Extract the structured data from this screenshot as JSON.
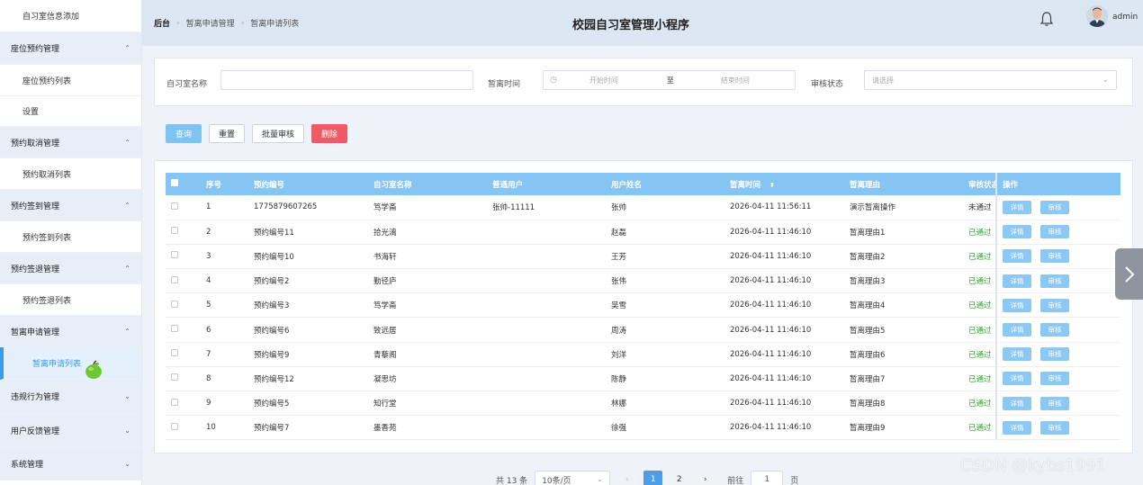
{
  "sidebar": {
    "items": [
      {
        "label": "自习室信息添加",
        "type": "sub"
      },
      {
        "label": "座位预约管理",
        "type": "group",
        "expanded": true
      },
      {
        "label": "座位预约列表",
        "type": "sub"
      },
      {
        "label": "设置",
        "type": "sub"
      },
      {
        "label": "预约取消管理",
        "type": "group",
        "expanded": true
      },
      {
        "label": "预约取消列表",
        "type": "sub"
      },
      {
        "label": "预约签到管理",
        "type": "group",
        "expanded": true
      },
      {
        "label": "预约签到列表",
        "type": "sub"
      },
      {
        "label": "预约签退管理",
        "type": "group",
        "expanded": true
      },
      {
        "label": "预约签退列表",
        "type": "sub"
      },
      {
        "label": "暂离申请管理",
        "type": "group",
        "expanded": true
      },
      {
        "label": "暂离申请列表",
        "type": "active"
      },
      {
        "label": "违规行为管理",
        "type": "group",
        "expanded": false
      },
      {
        "label": "用户反馈管理",
        "type": "group",
        "expanded": false
      },
      {
        "label": "系统管理",
        "type": "group",
        "expanded": false
      }
    ]
  },
  "header": {
    "breadcrumb": [
      "后台",
      "暂离申请管理",
      "暂离申请列表"
    ],
    "title": "校园自习室管理小程序",
    "username": "admin"
  },
  "search": {
    "room_label": "自习室名称",
    "time_label": "暂离时间",
    "start_placeholder": "开始时间",
    "range_sep": "至",
    "end_placeholder": "结束时间",
    "status_label": "审核状态",
    "status_placeholder": "请选择"
  },
  "actions": {
    "query": "查询",
    "reset": "重置",
    "batch_review": "批量审核",
    "delete": "删除"
  },
  "table": {
    "columns": [
      "序号",
      "预约编号",
      "自习室名称",
      "普通用户",
      "用户姓名",
      "暂离时间",
      "暂离理由",
      "审核状态",
      "操作"
    ],
    "detail_label": "详情",
    "review_label": "审核",
    "rows": [
      {
        "idx": "1",
        "no": "1775879607265",
        "room": "笃学斋",
        "user": "张帅-11111",
        "name": "张帅",
        "time": "2026-04-11 11:56:11",
        "reason": "演示暂离操作",
        "status": "未通过"
      },
      {
        "idx": "2",
        "no": "预约编号11",
        "room": "拾光漓",
        "user": "",
        "name": "赵磊",
        "time": "2026-04-11 11:46:10",
        "reason": "暂离理由1",
        "status": "已通过"
      },
      {
        "idx": "3",
        "no": "预约编号10",
        "room": "书海轩",
        "user": "",
        "name": "王芳",
        "time": "2026-04-11 11:46:10",
        "reason": "暂离理由2",
        "status": "已通过"
      },
      {
        "idx": "4",
        "no": "预约编号2",
        "room": "勤径庐",
        "user": "",
        "name": "张伟",
        "time": "2026-04-11 11:46:10",
        "reason": "暂离理由3",
        "status": "已通过"
      },
      {
        "idx": "5",
        "no": "预约编号3",
        "room": "笃学斋",
        "user": "",
        "name": "吴雪",
        "time": "2026-04-11 11:46:10",
        "reason": "暂离理由4",
        "status": "已通过"
      },
      {
        "idx": "6",
        "no": "预约编号6",
        "room": "致远居",
        "user": "",
        "name": "周涛",
        "time": "2026-04-11 11:46:10",
        "reason": "暂离理由5",
        "status": "已通过"
      },
      {
        "idx": "7",
        "no": "预约编号9",
        "room": "青藜阁",
        "user": "",
        "name": "刘洋",
        "time": "2026-04-11 11:46:10",
        "reason": "暂离理由6",
        "status": "已通过"
      },
      {
        "idx": "8",
        "no": "预约编号12",
        "room": "凝思坊",
        "user": "",
        "name": "陈静",
        "time": "2026-04-11 11:46:10",
        "reason": "暂离理由7",
        "status": "已通过"
      },
      {
        "idx": "9",
        "no": "预约编号5",
        "room": "知行堂",
        "user": "",
        "name": "林娜",
        "time": "2026-04-11 11:46:10",
        "reason": "暂离理由8",
        "status": "已通过"
      },
      {
        "idx": "10",
        "no": "预约编号7",
        "room": "墨香苑",
        "user": "",
        "name": "徐强",
        "time": "2026-04-11 11:46:10",
        "reason": "暂离理由9",
        "status": "已通过"
      }
    ]
  },
  "pagination": {
    "total": "共 13 条",
    "page_size": "10条/页",
    "pages": [
      "1",
      "2"
    ],
    "current": "1",
    "goto_label": "前往",
    "goto_value": "1",
    "page_suffix": "页"
  },
  "watermark": "CSDN @kybs1991",
  "colors": {
    "accent": "#3c9be6",
    "table_header": "#86c4f4",
    "danger": "#f05a64",
    "pass": "#2aa82a"
  }
}
